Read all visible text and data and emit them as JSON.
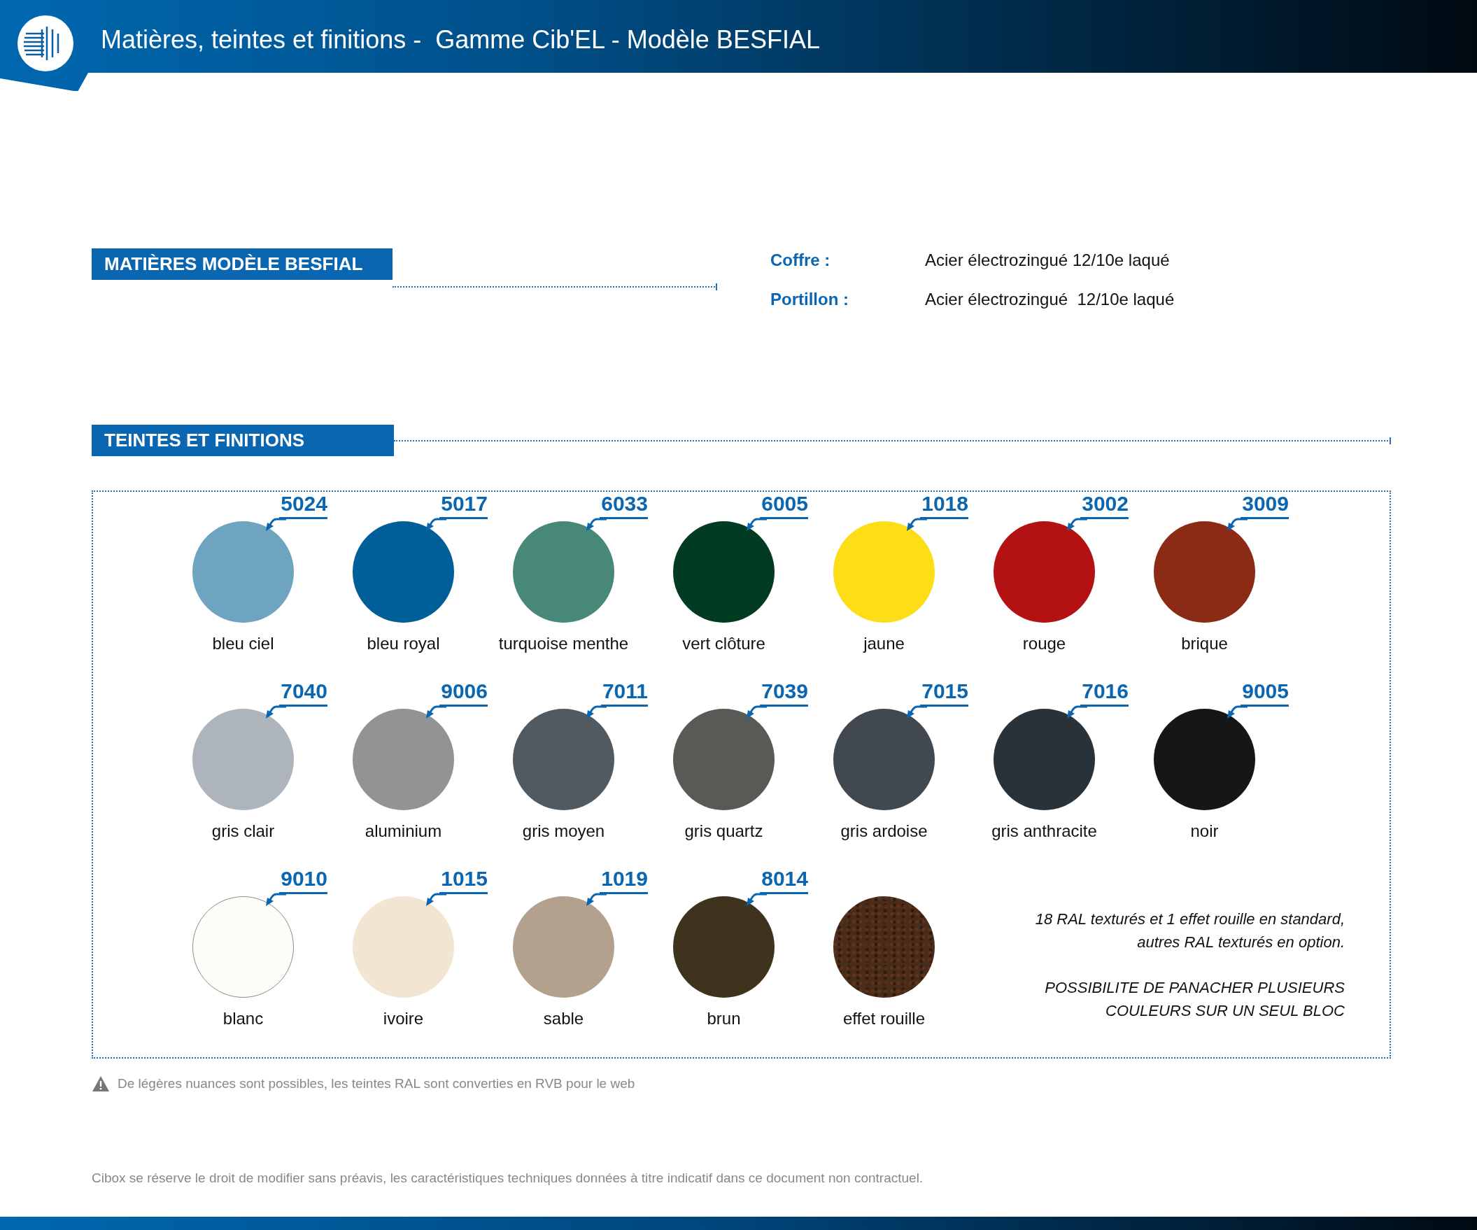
{
  "header": {
    "title": "Matières, teintes et finitions -  Gamme Cib'EL - Modèle BESFIAL"
  },
  "materials": {
    "heading": "MATIÈRES MODÈLE BESFIAL",
    "specs": [
      {
        "label": "Coffre :",
        "value": "Acier électrozingué 12/10e laqué"
      },
      {
        "label": "Portillon :",
        "value": "Acier électrozingué  12/10e laqué"
      }
    ]
  },
  "finishes": {
    "heading": "TEINTES ET FINITIONS",
    "swatches": [
      {
        "code": "5024",
        "name": "bleu ciel",
        "color": "#6ea4bf",
        "kind": "solid"
      },
      {
        "code": "5017",
        "name": "bleu royal",
        "color": "#005f98",
        "kind": "solid"
      },
      {
        "code": "6033",
        "name": "turquoise menthe",
        "color": "#478879",
        "kind": "solid"
      },
      {
        "code": "6005",
        "name": "vert clôture",
        "color": "#003b22",
        "kind": "solid"
      },
      {
        "code": "1018",
        "name": "jaune",
        "color": "#fddd16",
        "kind": "solid"
      },
      {
        "code": "3002",
        "name": "rouge",
        "color": "#b41113",
        "kind": "solid"
      },
      {
        "code": "3009",
        "name": "brique",
        "color": "#8b2b15",
        "kind": "solid"
      },
      {
        "code": "7040",
        "name": "gris clair",
        "color": "#adb4bb",
        "kind": "solid"
      },
      {
        "code": "9006",
        "name": "aluminium",
        "color": "#929494",
        "kind": "solid"
      },
      {
        "code": "7011",
        "name": "gris moyen",
        "color": "#525a61",
        "kind": "solid"
      },
      {
        "code": "7039",
        "name": "gris quartz",
        "color": "#595955",
        "kind": "solid"
      },
      {
        "code": "7015",
        "name": "gris ardoise",
        "color": "#41484f",
        "kind": "solid"
      },
      {
        "code": "7016",
        "name": "gris anthracite",
        "color": "#293238",
        "kind": "solid"
      },
      {
        "code": "9005",
        "name": "noir",
        "color": "#161616",
        "kind": "solid"
      },
      {
        "code": "9010",
        "name": "blanc",
        "color": "#fdfdf8",
        "kind": "outlined"
      },
      {
        "code": "1015",
        "name": "ivoire",
        "color": "#f2e6d2",
        "kind": "solid"
      },
      {
        "code": "1019",
        "name": "sable",
        "color": "#b3a18d",
        "kind": "solid"
      },
      {
        "code": "8014",
        "name": "brun",
        "color": "#40331e",
        "kind": "solid"
      },
      {
        "name": "effet rouille",
        "color": "#4a2c1a",
        "kind": "textured"
      }
    ],
    "note": [
      "18 RAL texturés et 1 effet rouille en standard, autres RAL texturés en option.",
      "POSSIBILITE DE PANACHER PLUSIEURS COULEURS SUR UN SEUL BLOC"
    ]
  },
  "warning": "De légères nuances sont possibles, les teintes RAL sont converties en RVB pour le web",
  "disclaimer": "Cibox se réserve le droit de modifier sans préavis, les caractéristiques techniques données à titre indicatif dans ce document non contractuel."
}
